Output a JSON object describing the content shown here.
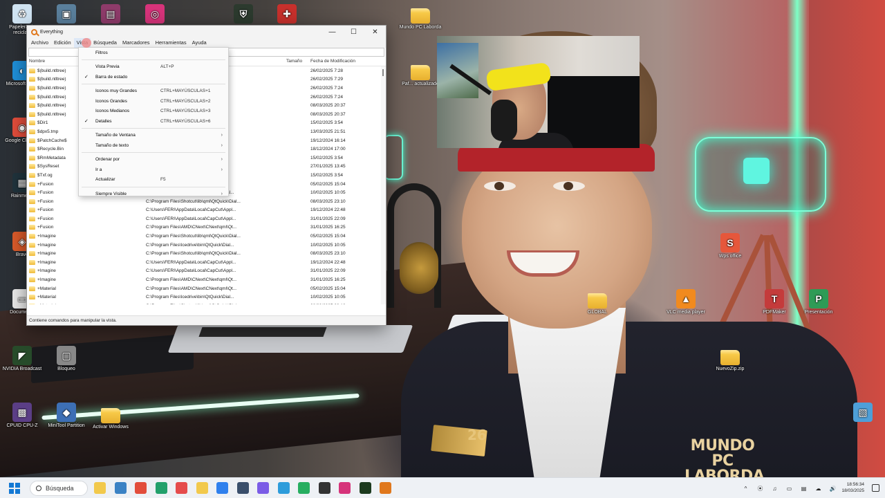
{
  "window": {
    "title": "Everything",
    "controls": [
      "—",
      "☐",
      "✕"
    ],
    "menubar": [
      "Archivo",
      "Edición",
      "Vista",
      "Búsqueda",
      "Marcadores",
      "Herramientas",
      "Ayuda"
    ],
    "search_value": "",
    "columns": [
      "Nombre",
      "Tamaño",
      "Fecha de Modificación"
    ],
    "rows": [
      {
        "name": "$(build.ntltree)",
        "path": "rosoft-wind...",
        "size": "",
        "date": "26/02/2025 7:28"
      },
      {
        "name": "$(build.ntltree)",
        "path": "rosoft-wind...",
        "size": "",
        "date": "26/02/2025 7:29"
      },
      {
        "name": "$(build.ntltree)",
        "path": "ht.fafbac1...",
        "size": "",
        "date": "26/02/2025 7:24"
      },
      {
        "name": "$(build.ntltree)",
        "path": "ht.fafbac1...",
        "size": "",
        "date": "26/02/2025 7:24"
      },
      {
        "name": "$(build.ntltree)",
        "path": "ht.7e02db5...",
        "size": "",
        "date": "08/03/2025 20:37"
      },
      {
        "name": "$(build.ntltree)",
        "path": "ht.7e02db5...",
        "size": "",
        "date": "08/03/2025 20:37"
      },
      {
        "name": "$Dir1",
        "path": "es (8)\\Archi...",
        "size": "",
        "date": "15/02/2025 3:54"
      },
      {
        "name": "$dpx5.tmp",
        "path": "\\Download...",
        "size": "",
        "date": "13/03/2025 21:51"
      },
      {
        "name": "$PatchCache$",
        "path": "",
        "size": "",
        "date": "19/12/2024 16:14"
      },
      {
        "name": "$Recycle.Bin",
        "path": "",
        "size": "",
        "date": "18/12/2024 17:00"
      },
      {
        "name": "$RmMetadata",
        "path": "es (8)\\Archi...",
        "size": "",
        "date": "15/02/2025 3:54"
      },
      {
        "name": "$SysReset",
        "path": "",
        "size": "",
        "date": "27/01/2025 13:45"
      },
      {
        "name": "$Txf.og",
        "path": "es (8)\\Archi...",
        "size": "",
        "date": "15/02/2025 3:54"
      },
      {
        "name": "+Fusion",
        "path": "C:\\Program Files\\Shotcut\\lib\\qml\\Qt...",
        "size": "",
        "date": "05/02/2025 15:04"
      },
      {
        "name": "+Fusion",
        "path": "C:\\Program Files\\Icedrive\\bin\\QtQuick\\Dial...",
        "size": "",
        "date": "10/02/2025 10:05"
      },
      {
        "name": "+Fusion",
        "path": "C:\\Program Files\\Shotcut\\lib\\qml\\QtQuick\\Dial...",
        "size": "",
        "date": "08/03/2025 23:10"
      },
      {
        "name": "+Fusion",
        "path": "C:\\Users\\FERI\\AppData\\Local\\CapCut\\Appl...",
        "size": "",
        "date": "19/12/2024 22:48"
      },
      {
        "name": "+Fusion",
        "path": "C:\\Users\\FERI\\AppData\\Local\\CapCut\\Appl...",
        "size": "",
        "date": "31/01/2025 22:09"
      },
      {
        "name": "+Fusion",
        "path": "C:\\Program Files\\AMD\\CNext\\CNext\\qml\\Qt...",
        "size": "",
        "date": "31/01/2025 16:25"
      },
      {
        "name": "+Imagine",
        "path": "C:\\Program Files\\Shotcut\\lib\\qml\\QtQuick\\Dial...",
        "size": "",
        "date": "05/02/2025 15:04"
      },
      {
        "name": "+Imagine",
        "path": "C:\\Program Files\\Icedrive\\bin\\QtQuick\\Dial...",
        "size": "",
        "date": "10/02/2025 10:05"
      },
      {
        "name": "+Imagine",
        "path": "C:\\Program Files\\Shotcut\\lib\\qml\\QtQuick\\Dial...",
        "size": "",
        "date": "08/03/2025 23:10"
      },
      {
        "name": "+Imagine",
        "path": "C:\\Users\\FERI\\AppData\\Local\\CapCut\\Appl...",
        "size": "",
        "date": "19/12/2024 22:48"
      },
      {
        "name": "+Imagine",
        "path": "C:\\Users\\FERI\\AppData\\Local\\CapCut\\Appl...",
        "size": "",
        "date": "31/01/2025 22:09"
      },
      {
        "name": "+Imagine",
        "path": "C:\\Program Files\\AMD\\CNext\\CNext\\qml\\Qt...",
        "size": "",
        "date": "31/01/2025 16:25"
      },
      {
        "name": "+Material",
        "path": "C:\\Program Files\\AMD\\CNext\\CNext\\qml\\Qt...",
        "size": "",
        "date": "05/02/2025 15:04"
      },
      {
        "name": "+Material",
        "path": "C:\\Program Files\\Icedrive\\bin\\QtQuick\\Dial...",
        "size": "",
        "date": "10/02/2025 10:05"
      },
      {
        "name": "+Material",
        "path": "C:\\Program Files\\Shotcut\\lib\\qml\\QtQuick\\Dial...",
        "size": "",
        "date": "08/03/2025 23:10"
      }
    ],
    "status": "Contiene comandos para manipular la vista."
  },
  "vista_menu": [
    {
      "label": "Filtros",
      "shortcut": "",
      "checked": false,
      "submenu": false
    },
    {
      "sep": true
    },
    {
      "label": "Vista Previa",
      "shortcut": "ALT+P",
      "checked": false,
      "submenu": false
    },
    {
      "label": "Barra de estado",
      "shortcut": "",
      "checked": true,
      "submenu": false
    },
    {
      "sep": true
    },
    {
      "label": "Iconos muy Grandes",
      "shortcut": "CTRL+MAYÚSCULAS+1",
      "checked": false,
      "submenu": false
    },
    {
      "label": "Iconos Grandes",
      "shortcut": "CTRL+MAYÚSCULAS+2",
      "checked": false,
      "submenu": false
    },
    {
      "label": "Iconos Medianos",
      "shortcut": "CTRL+MAYÚSCULAS+3",
      "checked": false,
      "submenu": false
    },
    {
      "label": "Detalles",
      "shortcut": "CTRL+MAYÚSCULAS+6",
      "checked": true,
      "submenu": false
    },
    {
      "sep": true
    },
    {
      "label": "Tamaño de Ventana",
      "shortcut": "",
      "checked": false,
      "submenu": true
    },
    {
      "label": "Tamaño de texto",
      "shortcut": "",
      "checked": false,
      "submenu": true
    },
    {
      "sep": true
    },
    {
      "label": "Ordenar por",
      "shortcut": "",
      "checked": false,
      "submenu": true
    },
    {
      "label": "Ir a",
      "shortcut": "",
      "checked": false,
      "submenu": true
    },
    {
      "label": "Actualizar",
      "shortcut": "F5",
      "checked": false,
      "submenu": false
    },
    {
      "sep": true
    },
    {
      "label": "Siempre Visible",
      "shortcut": "",
      "checked": false,
      "submenu": true
    }
  ],
  "desktop_icons": [
    {
      "label": "Papelera de reciclaje",
      "icon": "recycle-bin-icon",
      "kind": "app",
      "color": "#cfe3f2",
      "glyph": "♻"
    },
    {
      "label": "",
      "icon": "monitor-icon",
      "kind": "app",
      "color": "#5a7f9c",
      "glyph": "▣"
    },
    {
      "label": "",
      "icon": "winrar-icon",
      "kind": "app",
      "color": "#8e3b6a",
      "glyph": "▤"
    },
    {
      "label": "",
      "icon": "instagram-icon",
      "kind": "app",
      "color": "#d6337a",
      "glyph": "◎"
    },
    {
      "label": "",
      "icon": "shield-icon",
      "kind": "app",
      "color": "#2c3a2e",
      "glyph": "⛨"
    },
    {
      "label": "",
      "icon": "pdf-app-icon",
      "kind": "app",
      "color": "#c7302c",
      "glyph": "✚"
    },
    {
      "label": "Mundo PC Laborda",
      "icon": "folder-icon",
      "kind": "folder"
    },
    {
      "label": "Microsoft Edge",
      "icon": "edge-icon",
      "kind": "app",
      "color": "#1f8fd8",
      "glyph": "◐"
    },
    {
      "label": "Paf... actualizado",
      "icon": "folder-icon",
      "kind": "folder"
    },
    {
      "label": "Google Chrome",
      "icon": "chrome-icon",
      "kind": "app",
      "color": "#e24d3b",
      "glyph": "◉"
    },
    {
      "label": "Rainmeter",
      "icon": "app-icon",
      "kind": "app",
      "color": "#20333c",
      "glyph": "▦"
    },
    {
      "label": "Brave",
      "icon": "app-icon",
      "kind": "app",
      "color": "#d95a2a",
      "glyph": "◈"
    },
    {
      "label": "Documento",
      "icon": "file-icon",
      "kind": "app",
      "color": "#e9e9e9",
      "glyph": "▭"
    },
    {
      "label": "NVIDIA Broadcast",
      "icon": "nvidia-icon",
      "kind": "app",
      "color": "#274b2a",
      "glyph": "◤"
    },
    {
      "label": "Bloqueo",
      "icon": "lock-icon",
      "kind": "app",
      "color": "#888888",
      "glyph": "▢"
    },
    {
      "label": "CPUID CPU-Z",
      "icon": "cpuz-icon",
      "kind": "app",
      "color": "#5b3e86",
      "glyph": "▩"
    },
    {
      "label": "MiniTool Partition",
      "icon": "minitool-icon",
      "kind": "app",
      "color": "#3d6fb5",
      "glyph": "◆"
    },
    {
      "label": "Activar Windows",
      "icon": "folder-icon",
      "kind": "folder"
    },
    {
      "label": "Wps office",
      "icon": "wps-icon",
      "kind": "app",
      "color": "#e6573b",
      "glyph": "S"
    },
    {
      "label": "GLOBAL",
      "icon": "folder-icon",
      "kind": "folder"
    },
    {
      "label": "VLC media player",
      "icon": "vlc-icon",
      "kind": "app",
      "color": "#f18a1e",
      "glyph": "▲"
    },
    {
      "label": "PDFMaker",
      "icon": "pdfmaker-icon",
      "kind": "app",
      "color": "#c43b3b",
      "glyph": "T"
    },
    {
      "label": "Presentación",
      "icon": "presentation-icon",
      "kind": "app",
      "color": "#2e9b56",
      "glyph": "P"
    },
    {
      "label": "NuevoZip.zip",
      "icon": "zip-folder-icon",
      "kind": "folder"
    },
    {
      "label": "",
      "icon": "screen-icon",
      "kind": "app",
      "color": "#4e9fd8",
      "glyph": "▧"
    }
  ],
  "wallpaper": {
    "badge_number": "26",
    "brand_line1": "MUNDO PC",
    "brand_line2": "LABORDA"
  },
  "taskbar": {
    "search_label": "Búsqueda",
    "apps": [
      {
        "icon": "file-explorer-icon",
        "color": "#f2c94c"
      },
      {
        "icon": "task-view-icon",
        "color": "#3b82c4"
      },
      {
        "icon": "chrome-icon",
        "color": "#e24d3b"
      },
      {
        "icon": "edge-icon",
        "color": "#22a06b"
      },
      {
        "icon": "app-icon",
        "color": "#e54c4c"
      },
      {
        "icon": "folder-icon",
        "color": "#f2c94c"
      },
      {
        "icon": "app-icon",
        "color": "#2f80ed"
      },
      {
        "icon": "app-icon",
        "color": "#3a4f6b"
      },
      {
        "icon": "app-icon",
        "color": "#7b5ce6"
      },
      {
        "icon": "app-icon",
        "color": "#2d9cdb"
      },
      {
        "icon": "app-icon",
        "color": "#27ae60"
      },
      {
        "icon": "app-icon",
        "color": "#333333"
      },
      {
        "icon": "instagram-icon",
        "color": "#d6337a"
      },
      {
        "icon": "terminal-icon",
        "color": "#1c3a1e"
      },
      {
        "icon": "everything-icon",
        "color": "#e0781d"
      }
    ],
    "tray": [
      "^",
      "⦿",
      "♫",
      "▭",
      "▤",
      "☁",
      "🔊"
    ],
    "time": "18:56:34",
    "date": "18/03/2025"
  }
}
